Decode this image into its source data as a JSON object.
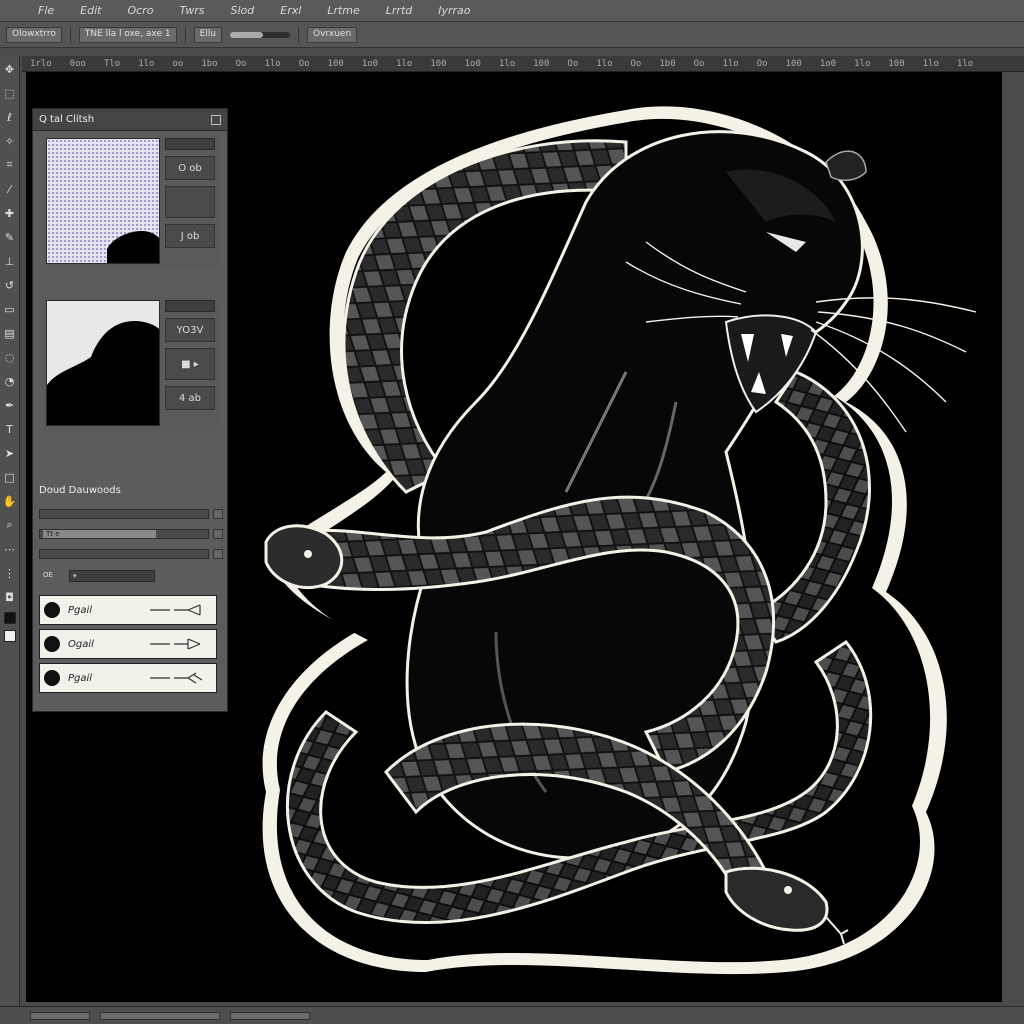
{
  "menubar": {
    "items": [
      "Fle",
      "Edit",
      "Ocro",
      "Twrs",
      "Slod",
      "Erxl",
      "Lrtme",
      "Lrrtd",
      "Iyrrao"
    ]
  },
  "optionsbar": {
    "fields": [
      "Olowxtrro",
      "TNE lla l oxe, axe 1",
      "Ellu",
      "Ovrxuen"
    ]
  },
  "ruler": {
    "labels": [
      "1rlo",
      "0oo",
      "Tlo",
      "1lo",
      "oo",
      "1bo",
      "Oo",
      "1lo",
      "Oo",
      "100",
      "1o0",
      "1lo",
      "100",
      "1o0",
      "1lo",
      "100",
      "Oo",
      "1lo",
      "Oo",
      "1b0",
      "Oo",
      "1lo",
      "Oo",
      "100",
      "1o0",
      "1lo",
      "100",
      "1lo",
      "1lo"
    ]
  },
  "panel": {
    "title": "Q tal Clitsh",
    "thumb1": {
      "field": "",
      "button1": "O ob",
      "button3": "J ob"
    },
    "thumb2_label": "",
    "thumb2": {
      "field": "",
      "button1": "YO3V",
      "button3": "4 ab"
    },
    "section_title": "Doud Dauwoods",
    "slider1": "",
    "slider2": "Tt e",
    "slider3": "",
    "drop_label": "OE",
    "paths": [
      {
        "name": "Pgail"
      },
      {
        "name": "Ogail"
      },
      {
        "name": "Pgail"
      }
    ]
  },
  "colors": {
    "accent": "#a89cd8",
    "canvas_bg": "#000000",
    "ui_bg": "#4a4a4a"
  }
}
